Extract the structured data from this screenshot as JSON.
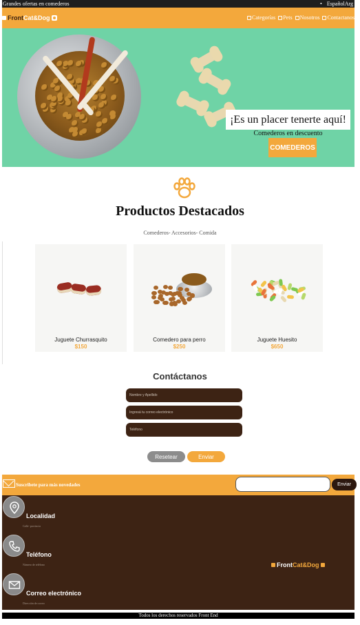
{
  "topbar": {
    "promo": "Grandes ofertas en comederos",
    "bullet": "•",
    "language": "EspañolArg"
  },
  "nav": {
    "logo_front": "Front",
    "logo_catdog": "Cat&Dog",
    "links": [
      "Categorías",
      "Pets",
      "Nosotros",
      "Contactanos"
    ]
  },
  "hero": {
    "headline": "¡Es un placer tenerte aquí!",
    "subline": "Comederos en descuento",
    "button": "COMEDEROS"
  },
  "featured": {
    "title": "Productos Destacados",
    "subtitle": "Comederos- Accesorios- Comida",
    "products": [
      {
        "name": "Juguete Churrasquito",
        "price": "$150"
      },
      {
        "name": "Comedero para perro",
        "price": "$250"
      },
      {
        "name": "Juguete Huesito",
        "price": "$650"
      }
    ]
  },
  "contact": {
    "title": "Contáctanos",
    "name_placeholder": "Nombre y Apellido",
    "email_placeholder": "Ingresá tu correo electrónico",
    "phone_placeholder": "Teléfono",
    "reset_label": "Resetear",
    "send_label": "Enviar"
  },
  "subscribe": {
    "text": "Suscribete para más novedades",
    "button": "Enviar"
  },
  "footer": {
    "items": [
      {
        "label": "Localidad",
        "sub": "Calle- provincia"
      },
      {
        "label": "Teléfono",
        "sub": "Número de teléfono"
      },
      {
        "label": "Correo electrónico",
        "sub": "Dirección de correo"
      }
    ],
    "logo_front": "Front",
    "logo_catdog": "Cat&Dog",
    "copyright": "Todos los derechos reservados Front End"
  },
  "colors": {
    "accent": "#f3a83c",
    "brown": "#3d2314",
    "hero_bg": "#6fd3a6"
  },
  "icons": [
    "paw-icon",
    "location-icon",
    "phone-icon",
    "mail-icon"
  ]
}
